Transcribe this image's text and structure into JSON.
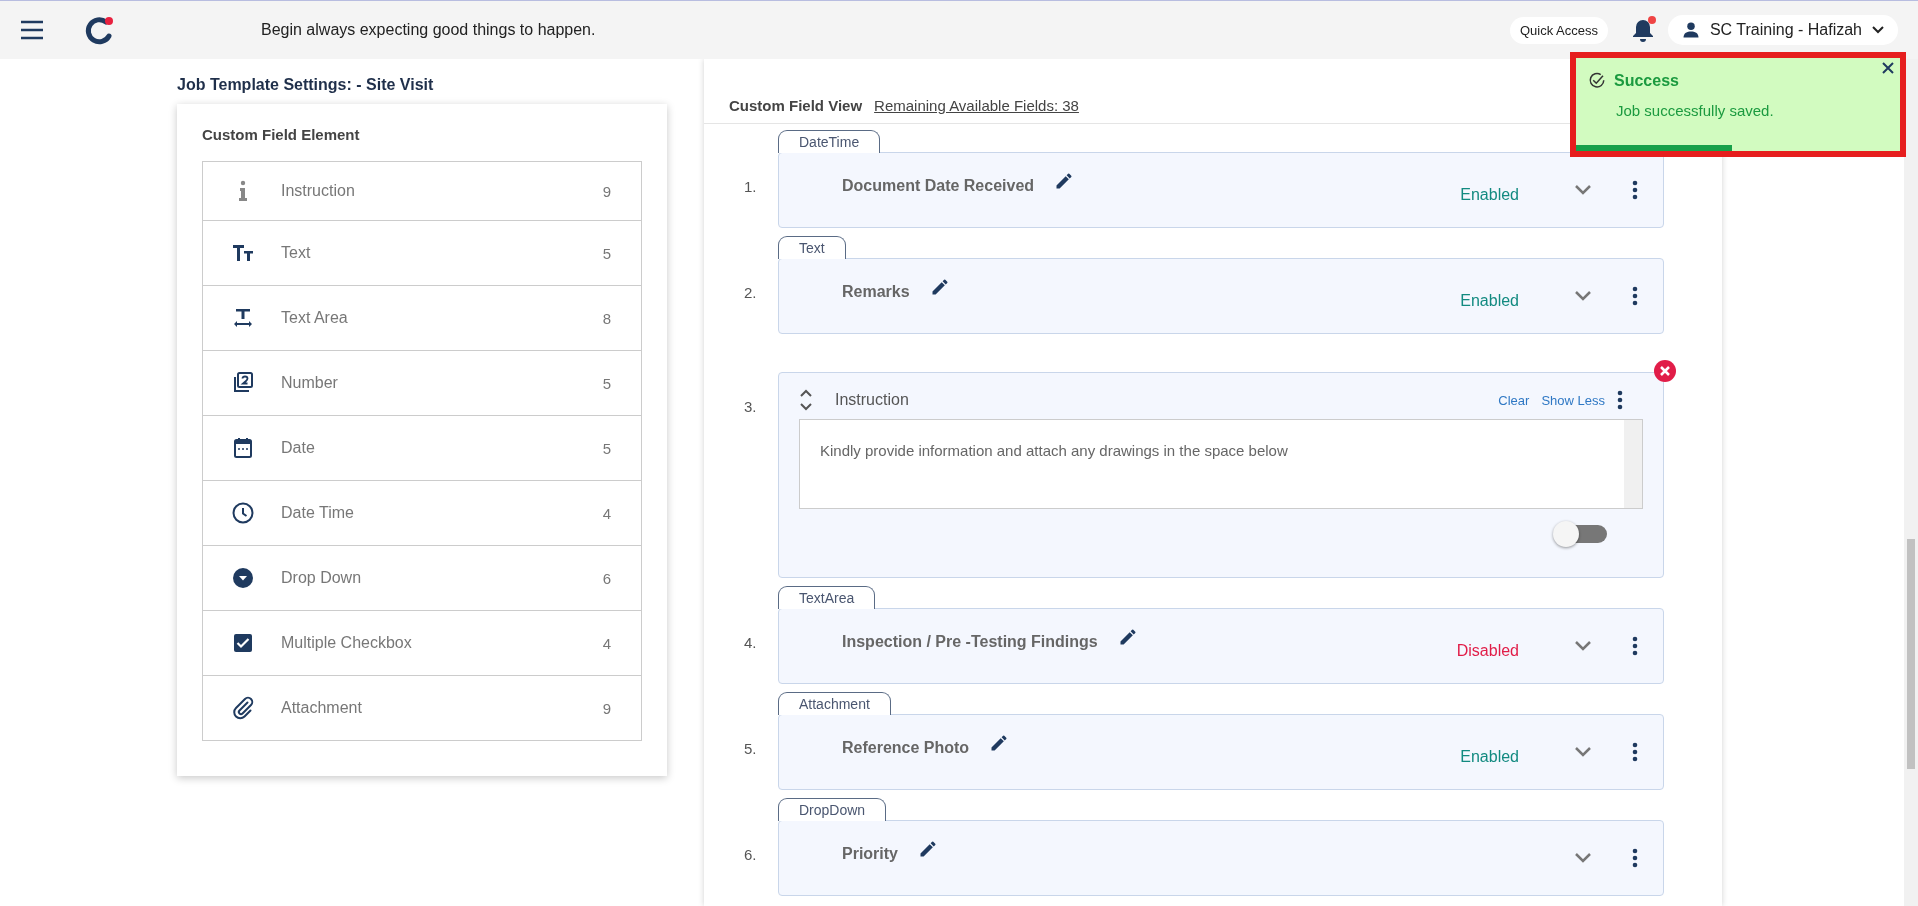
{
  "header": {
    "motto": "Begin always expecting good things to happen.",
    "quick_access": "Quick Access",
    "notification_unread": true,
    "user": "SC Training - Hafizah"
  },
  "page_title": "Job Template Settings: - Site Visit",
  "element_panel": {
    "title": "Custom Field Element",
    "items": [
      {
        "kind": "instruction",
        "label": "Instruction",
        "count": "9"
      },
      {
        "kind": "text",
        "label": "Text",
        "count": "5"
      },
      {
        "kind": "textarea",
        "label": "Text Area",
        "count": "8"
      },
      {
        "kind": "number",
        "label": "Number",
        "count": "5"
      },
      {
        "kind": "date",
        "label": "Date",
        "count": "5"
      },
      {
        "kind": "datetime",
        "label": "Date Time",
        "count": "4"
      },
      {
        "kind": "dropdown",
        "label": "Drop Down",
        "count": "6"
      },
      {
        "kind": "checkbox",
        "label": "Multiple Checkbox",
        "count": "4"
      },
      {
        "kind": "attachment",
        "label": "Attachment",
        "count": "9"
      }
    ]
  },
  "field_view": {
    "title": "Custom Field View",
    "remaining": "Remaining Available Fields: 38",
    "fields": [
      {
        "number": "1.",
        "tag": "DateTime",
        "label": "Document Date Received",
        "expanded": false,
        "enabled": true,
        "status": "Enabled"
      },
      {
        "number": "2.",
        "tag": "Text",
        "label": "Remarks",
        "expanded": false,
        "enabled": true,
        "status": "Enabled"
      },
      {
        "number": "3.",
        "label": "Instruction",
        "expanded": true,
        "clear": "Clear",
        "show_less": "Show Less",
        "value": "Kindly provide information and attach any drawings in the space below",
        "toggle_on": false
      },
      {
        "number": "4.",
        "tag": "TextArea",
        "label": "Inspection / Pre -Testing Findings",
        "expanded": false,
        "enabled": false,
        "status": "Disabled"
      },
      {
        "number": "5.",
        "tag": "Attachment",
        "label": "Reference Photo",
        "expanded": false,
        "enabled": true,
        "status": "Enabled"
      },
      {
        "number": "6.",
        "tag": "DropDown",
        "label": "Priority",
        "expanded": false
      }
    ]
  },
  "toast": {
    "title": "Success",
    "message": "Job successfully saved.",
    "level": 0.48
  }
}
